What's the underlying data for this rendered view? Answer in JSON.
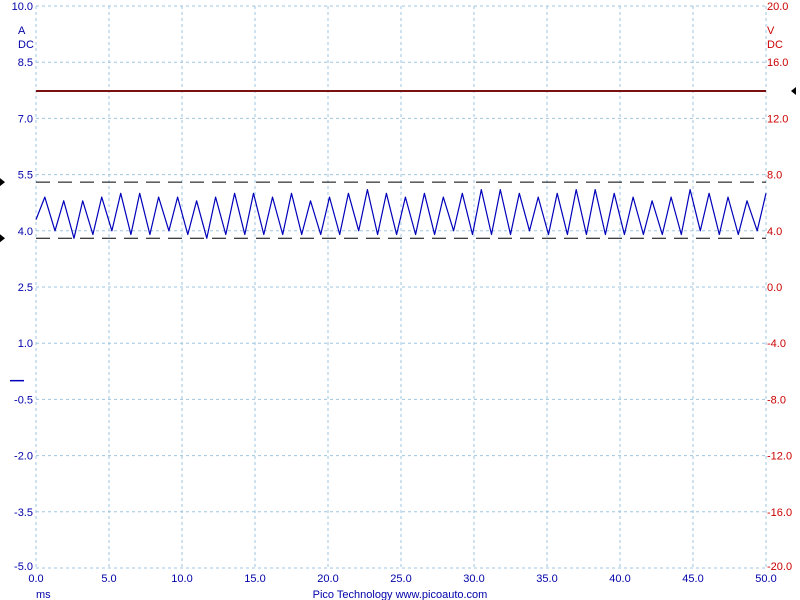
{
  "chart_data": {
    "type": "line",
    "title": "",
    "x_unit": "ms",
    "x_range": [
      0,
      50
    ],
    "x_ticks": [
      "0.0",
      "5.0",
      "10.0",
      "15.0",
      "20.0",
      "25.0",
      "30.0",
      "35.0",
      "40.0",
      "45.0",
      "50.0"
    ],
    "left_axis": {
      "unit": "A",
      "coupling": "DC",
      "range": [
        -5,
        10
      ],
      "ticks": [
        "10.0",
        "8.5",
        "7.0",
        "5.5",
        "4.0",
        "2.5",
        "1.0",
        "-0.5",
        "-2.0",
        "-3.5",
        "-5.0"
      ],
      "color": "#0000aa"
    },
    "right_axis": {
      "unit": "V",
      "coupling": "DC",
      "range": [
        -20,
        20
      ],
      "ticks": [
        "20.0",
        "16.0",
        "12.0",
        "8.0",
        "4.0",
        "0.0",
        "-4.0",
        "-8.0",
        "-12.0",
        "-16.0",
        "-20.0"
      ],
      "color": "#cc0000"
    },
    "grid": true,
    "grid_color": "#9fc6e0",
    "series": [
      {
        "axis": "left",
        "color": "#0000bb",
        "unit": "A",
        "x": [
          0,
          0.6,
          1.3,
          1.9,
          2.6,
          3.2,
          3.9,
          4.5,
          5.2,
          5.8,
          6.5,
          7.1,
          7.8,
          8.4,
          9.1,
          9.7,
          10.4,
          11.0,
          11.7,
          12.3,
          13.0,
          13.6,
          14.3,
          14.9,
          15.6,
          16.2,
          16.9,
          17.5,
          18.2,
          18.8,
          19.5,
          20.1,
          20.8,
          21.4,
          22.1,
          22.7,
          23.4,
          24.0,
          24.7,
          25.3,
          26.0,
          26.6,
          27.3,
          27.9,
          28.6,
          29.2,
          29.9,
          30.5,
          31.2,
          31.8,
          32.5,
          33.1,
          33.8,
          34.4,
          35.1,
          35.7,
          36.4,
          37.0,
          37.7,
          38.3,
          39.0,
          39.6,
          40.3,
          40.9,
          41.6,
          42.2,
          42.9,
          43.5,
          44.2,
          44.8,
          45.5,
          46.1,
          46.8,
          47.4,
          48.1,
          48.7,
          49.4,
          50.0
        ],
        "values": [
          4.3,
          4.9,
          4.0,
          4.8,
          3.8,
          4.8,
          3.9,
          4.9,
          4.0,
          5.0,
          3.9,
          5.0,
          3.9,
          4.9,
          4.0,
          4.9,
          3.9,
          4.8,
          3.8,
          4.9,
          3.9,
          5.0,
          3.9,
          5.0,
          3.9,
          4.9,
          3.9,
          5.0,
          3.9,
          4.8,
          3.9,
          4.9,
          3.9,
          5.0,
          4.0,
          5.1,
          3.9,
          5.0,
          3.9,
          4.9,
          3.9,
          5.0,
          3.9,
          4.9,
          4.0,
          5.0,
          3.9,
          5.1,
          3.9,
          5.1,
          3.9,
          5.0,
          4.0,
          4.9,
          3.9,
          5.0,
          3.9,
          5.1,
          3.9,
          5.1,
          3.9,
          5.0,
          3.9,
          4.9,
          3.9,
          4.8,
          3.9,
          4.9,
          3.9,
          5.1,
          4.0,
          5.0,
          3.9,
          4.9,
          3.9,
          4.8,
          4.0,
          5.0
        ]
      },
      {
        "axis": "right",
        "color": "#7a1010",
        "unit": "V",
        "x": [
          0,
          50
        ],
        "values": [
          13.95,
          13.95
        ]
      }
    ],
    "cursor_lines": [
      5.3,
      3.8
    ],
    "cursor_line_style": "dashed",
    "footer": "Pico Technology   www.picoauto.com"
  }
}
